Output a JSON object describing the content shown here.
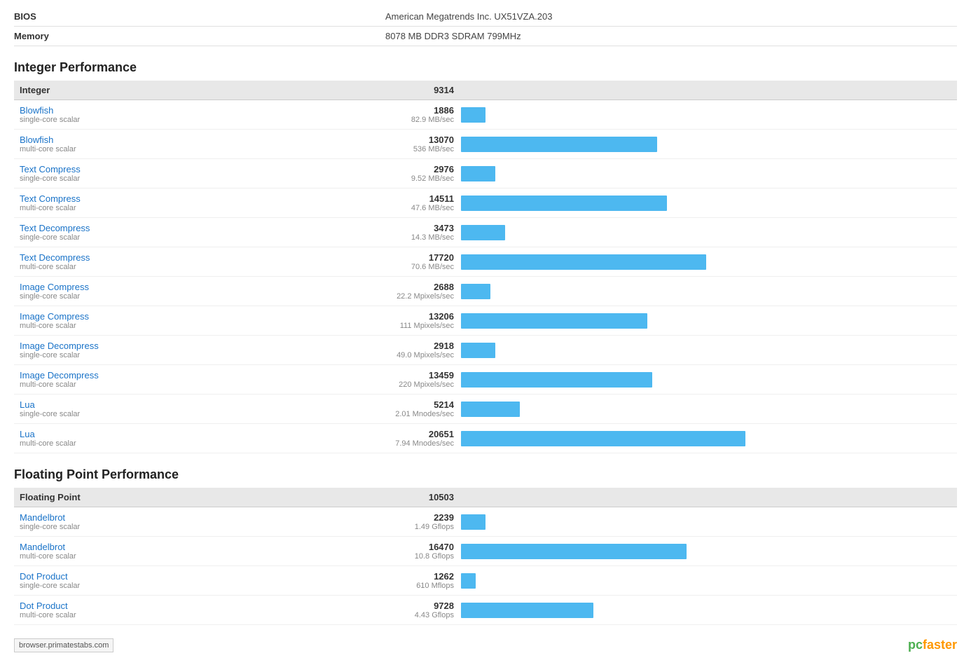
{
  "system": {
    "bios_label": "BIOS",
    "bios_value": "American Megatrends Inc. UX51VZA.203",
    "memory_label": "Memory",
    "memory_value": "8078 MB DDR3 SDRAM 799MHz"
  },
  "integer_section": {
    "title": "Integer Performance",
    "header_name": "Integer",
    "header_score": "9314",
    "rows": [
      {
        "name": "Blowfish",
        "sub": "single-core scalar",
        "score": "1886",
        "unit": "82.9 MB/sec",
        "bar_pct": 5
      },
      {
        "name": "Blowfish",
        "sub": "multi-core scalar",
        "score": "13070",
        "unit": "536 MB/sec",
        "bar_pct": 40
      },
      {
        "name": "Text Compress",
        "sub": "single-core scalar",
        "score": "2976",
        "unit": "9.52 MB/sec",
        "bar_pct": 7
      },
      {
        "name": "Text Compress",
        "sub": "multi-core scalar",
        "score": "14511",
        "unit": "47.6 MB/sec",
        "bar_pct": 42
      },
      {
        "name": "Text Decompress",
        "sub": "single-core scalar",
        "score": "3473",
        "unit": "14.3 MB/sec",
        "bar_pct": 9
      },
      {
        "name": "Text Decompress",
        "sub": "multi-core scalar",
        "score": "17720",
        "unit": "70.6 MB/sec",
        "bar_pct": 50
      },
      {
        "name": "Image Compress",
        "sub": "single-core scalar",
        "score": "2688",
        "unit": "22.2 Mpixels/sec",
        "bar_pct": 6
      },
      {
        "name": "Image Compress",
        "sub": "multi-core scalar",
        "score": "13206",
        "unit": "111 Mpixels/sec",
        "bar_pct": 38
      },
      {
        "name": "Image Decompress",
        "sub": "single-core scalar",
        "score": "2918",
        "unit": "49.0 Mpixels/sec",
        "bar_pct": 7
      },
      {
        "name": "Image Decompress",
        "sub": "multi-core scalar",
        "score": "13459",
        "unit": "220 Mpixels/sec",
        "bar_pct": 39
      },
      {
        "name": "Lua",
        "sub": "single-core scalar",
        "score": "5214",
        "unit": "2.01 Mnodes/sec",
        "bar_pct": 12
      },
      {
        "name": "Lua",
        "sub": "multi-core scalar",
        "score": "20651",
        "unit": "7.94 Mnodes/sec",
        "bar_pct": 58
      }
    ]
  },
  "floating_section": {
    "title": "Floating Point Performance",
    "header_name": "Floating Point",
    "header_score": "10503",
    "rows": [
      {
        "name": "Mandelbrot",
        "sub": "single-core scalar",
        "score": "2239",
        "unit": "1.49 Gflops",
        "bar_pct": 5
      },
      {
        "name": "Mandelbrot",
        "sub": "multi-core scalar",
        "score": "16470",
        "unit": "10.8 Gflops",
        "bar_pct": 46
      },
      {
        "name": "Dot Product",
        "sub": "single-core scalar",
        "score": "1262",
        "unit": "610 Mflops",
        "bar_pct": 3
      },
      {
        "name": "Dot Product",
        "sub": "multi-core scalar",
        "score": "9728",
        "unit": "4.43 Gflops",
        "bar_pct": 27
      }
    ]
  },
  "footer": {
    "url": "browser.primatestabs.com",
    "logo_pc": "pc",
    "logo_faster": "faster"
  }
}
